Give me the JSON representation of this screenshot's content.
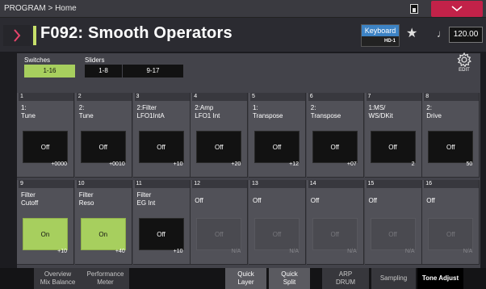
{
  "topbar": {
    "breadcrumb": "PROGRAM > Home",
    "battery_icon": "battery-icon",
    "menu_icon": "chevron-down-icon",
    "menu_color": "#c22249"
  },
  "header": {
    "program_title": "F092: Smooth Operators",
    "category_main": "Keyboard",
    "category_sub": "HD-1",
    "favorite_icon": "star-icon",
    "tempo_icon": "quarter-note-icon",
    "tempo_glyph": "♩",
    "tempo": "120.00",
    "accent_color": "#c7e06a"
  },
  "controls": {
    "switches_label": "Switches",
    "switches_range": "1-16",
    "sliders_label": "Sliders",
    "sliders_range1": "1-8",
    "sliders_range2": "9-17",
    "edit_label": "EDIT"
  },
  "cells": [
    {
      "num": "1",
      "name": "1:\nTune",
      "button": "Off",
      "value": "+0000",
      "state": "off"
    },
    {
      "num": "2",
      "name": "2:\nTune",
      "button": "Off",
      "value": "+0010",
      "state": "off"
    },
    {
      "num": "3",
      "name": "2:Filter\nLFO1IntA",
      "button": "Off",
      "value": "+10",
      "state": "off"
    },
    {
      "num": "4",
      "name": "2:Amp\nLFO1 Int",
      "button": "Off",
      "value": "+20",
      "state": "off"
    },
    {
      "num": "5",
      "name": "1:\nTranspose",
      "button": "Off",
      "value": "+12",
      "state": "off"
    },
    {
      "num": "6",
      "name": "2:\nTranspose",
      "button": "Off",
      "value": "+07",
      "state": "off"
    },
    {
      "num": "7",
      "name": "1:MS/\nWS/DKit",
      "button": "Off",
      "value": "2",
      "state": "off"
    },
    {
      "num": "8",
      "name": "2:\nDrive",
      "button": "Off",
      "value": "50",
      "state": "off"
    },
    {
      "num": "9",
      "name": "Filter\nCutoff",
      "button": "On",
      "value": "+10",
      "state": "on"
    },
    {
      "num": "10",
      "name": "Filter\nReso",
      "button": "On",
      "value": "+40",
      "state": "on"
    },
    {
      "num": "11",
      "name": "Filter\nEG Int",
      "button": "Off",
      "value": "+10",
      "state": "off"
    },
    {
      "num": "12",
      "name": "Off",
      "button": "Off",
      "value": "N/A",
      "state": "disabled"
    },
    {
      "num": "13",
      "name": "Off",
      "button": "Off",
      "value": "N/A",
      "state": "disabled"
    },
    {
      "num": "14",
      "name": "Off",
      "button": "Off",
      "value": "N/A",
      "state": "disabled"
    },
    {
      "num": "15",
      "name": "Off",
      "button": "Off",
      "value": "N/A",
      "state": "disabled"
    },
    {
      "num": "16",
      "name": "Off",
      "button": "Off",
      "value": "N/A",
      "state": "disabled"
    }
  ],
  "tabs": [
    {
      "label": "Overview\nMix Balance",
      "style": "dark"
    },
    {
      "label": "Performance\nMeter",
      "style": "dark"
    },
    {
      "label": "Quick\nLayer",
      "style": "light"
    },
    {
      "label": "Quick\nSplit",
      "style": "light"
    },
    {
      "label": "ARP\nDRUM",
      "style": "dark"
    },
    {
      "label": "Sampling",
      "style": "dark"
    },
    {
      "label": "Tone Adjust",
      "style": "active"
    }
  ]
}
